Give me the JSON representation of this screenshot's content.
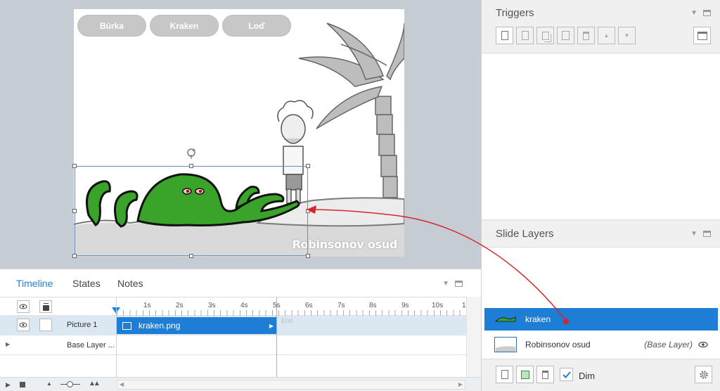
{
  "slide": {
    "buttons": [
      "Búrka",
      "Kraken",
      "Loď"
    ],
    "caption": "Robinsonov osud"
  },
  "triggers": {
    "title": "Triggers"
  },
  "slide_layers": {
    "title": "Slide Layers",
    "layers": [
      {
        "name": "kraken",
        "selected": true,
        "tag": ""
      },
      {
        "name": "Robinsonov osud",
        "selected": false,
        "tag": "(Base Layer)"
      }
    ],
    "dim_label": "Dim",
    "dim_checked": true
  },
  "timeline": {
    "tabs": [
      "Timeline",
      "States",
      "Notes"
    ],
    "active_tab": "Timeline",
    "ticks": [
      "1s",
      "2s",
      "3s",
      "4s",
      "5s",
      "6s",
      "7s",
      "8s",
      "9s",
      "10s",
      "1"
    ],
    "rows": [
      {
        "name": "Picture 1",
        "clip": "kraken.png"
      },
      {
        "name": "Base Layer ..."
      }
    ],
    "end_label": "End"
  },
  "colors": {
    "accent": "#1e7ed6",
    "annotation": "#d6262c",
    "kraken_green": "#3aa32a"
  }
}
